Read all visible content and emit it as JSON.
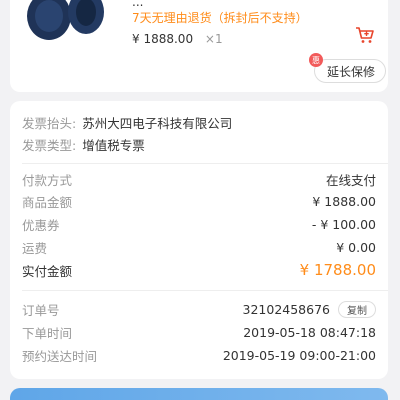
{
  "product": {
    "truncated_title": "...",
    "return_policy": "7天无理由退货（拆封后不支持）",
    "price": "¥ 1888.00",
    "quantity": "×1",
    "extend_warranty_label": "延长保修",
    "extend_badge": "惠"
  },
  "invoice": {
    "header_label": "发票抬头:",
    "header_value": "苏州大四电子科技有限公司",
    "type_label": "发票类型:",
    "type_value": "增值税专票"
  },
  "payment": {
    "method_label": "付款方式",
    "method_value": "在线支付",
    "goods_label": "商品金额",
    "goods_value": "¥ 1888.00",
    "coupon_label": "优惠券",
    "coupon_value": "- ¥ 100.00",
    "shipping_label": "运费",
    "shipping_value": "¥ 0.00",
    "paid_label": "实付金额",
    "paid_value": "¥ 1788.00"
  },
  "order": {
    "number_label": "订单号",
    "number_value": "32102458676",
    "copy_label": "复制",
    "time_label": "下单时间",
    "time_value": "2019-05-18 08:47:18",
    "delivery_label": "预约送达时间",
    "delivery_value": "2019-05-19 09:00-21:00"
  },
  "colors": {
    "accent_orange": "#ff8c1a",
    "cart_red": "#e8452c",
    "product_blue": "#1f3357"
  },
  "icons": [
    "headphones-image",
    "cart-icon"
  ]
}
